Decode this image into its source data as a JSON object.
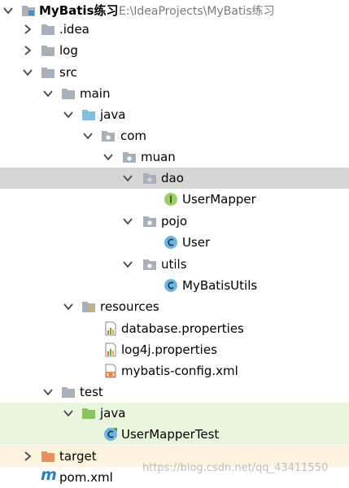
{
  "tree": {
    "root": {
      "label": "MyBatis练习",
      "path": "E:\\IdeaProjects\\MyBatis练习"
    },
    "idea": "idea",
    "idea_label": ".idea",
    "log": "log",
    "src": "src",
    "main": "main",
    "main_java": "java",
    "com": "com",
    "muan": "muan",
    "dao": "dao",
    "user_mapper": "UserMapper",
    "pojo": "pojo",
    "user": "User",
    "utils": "utils",
    "mybatis_utils": "MyBatisUtils",
    "resources": "resources",
    "database_properties": "database.properties",
    "log4j_properties": "log4j.properties",
    "mybatis_config": "mybatis-config.xml",
    "test": "test",
    "test_java": "java",
    "user_mapper_test": "UserMapperTest",
    "target": "target",
    "pom": "pom.xml"
  },
  "watermark": "https://blog.csdn.net/qq_43411550",
  "colors": {
    "selection": "#d5d5d5",
    "test_folder": "#eaf5de",
    "excluded_folder": "#fbf3dd",
    "folder_gray": "#a9b0b7",
    "source_folder": "#7fbfe0",
    "test_source_folder": "#89c45d",
    "target_folder": "#e8915a",
    "class_icon": "#6fb5e0",
    "interface_icon": "#9ccc65"
  },
  "icons": {
    "expand": "chevron-down-icon",
    "collapse": "chevron-right-icon",
    "folder": "folder-icon",
    "package": "package-icon",
    "class": "class-icon",
    "interface": "interface-icon",
    "properties": "properties-file-icon",
    "xml": "xml-file-icon",
    "maven": "maven-icon",
    "test_class": "test-class-icon"
  }
}
